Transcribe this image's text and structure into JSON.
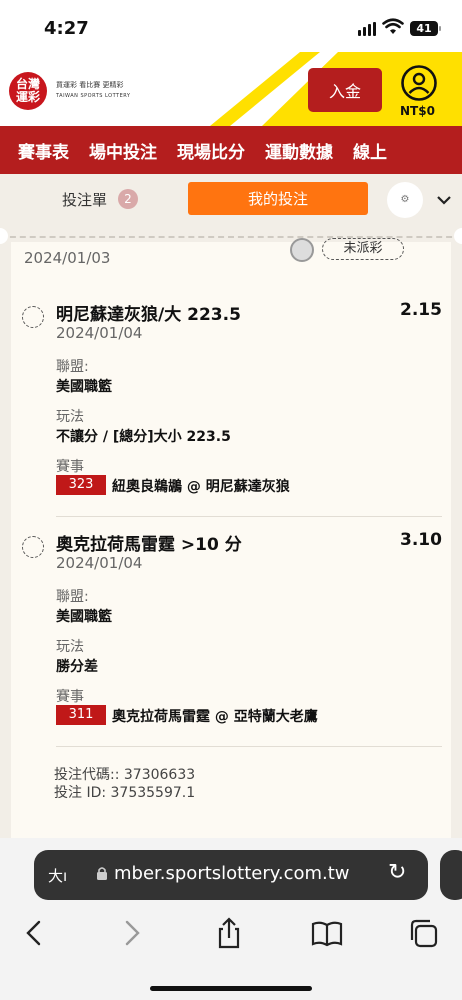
{
  "status": {
    "time": "4:27",
    "battery": "41"
  },
  "header": {
    "logo_text": "台灣\n運彩",
    "logo_line1": "買運彩  看比賽  更精彩",
    "logo_line2": "TAIWAN SPORTS LOTTERY",
    "deposit_label": "入金",
    "balance": "NT$0"
  },
  "nav": {
    "items": [
      "賽事表",
      "場中投注",
      "現場比分",
      "運動數據",
      "線上"
    ]
  },
  "slip": {
    "label": "投注單",
    "count": "2",
    "my_bets_label": "我的投注"
  },
  "prev": {
    "date": "2024/01/03",
    "tag": "未派彩"
  },
  "bets": [
    {
      "title": "明尼蘇達灰狼/大 223.5",
      "odds": "2.15",
      "date": "2024/01/04",
      "league_label": "聯盟:",
      "league": "美國職籃",
      "play_label": "玩法",
      "play": "不讓分 / [總分]大小 223.5",
      "event_label": "賽事",
      "event_no": "323",
      "event": "紐奧良鵜鶘 @ 明尼蘇達灰狼"
    },
    {
      "title": "奧克拉荷馬雷霆 >10 分",
      "odds": "3.10",
      "date": "2024/01/04",
      "league_label": "聯盟:",
      "league": "美國職籃",
      "play_label": "玩法",
      "play": "勝分差",
      "event_label": "賽事",
      "event_no": "311",
      "event": "奧克拉荷馬雷霆 @ 亞特蘭大老鷹"
    }
  ],
  "codes": {
    "bet_code": "投注代碼:: 37306633",
    "bet_id": "投注 ID: 37535597.1"
  },
  "browser": {
    "aa": "大ı",
    "url": "mber.sportslottery.com.tw"
  },
  "colors": {
    "brand_red": "#b41e1e",
    "accent_orange": "#ff7410",
    "yellow": "#ffe000"
  }
}
